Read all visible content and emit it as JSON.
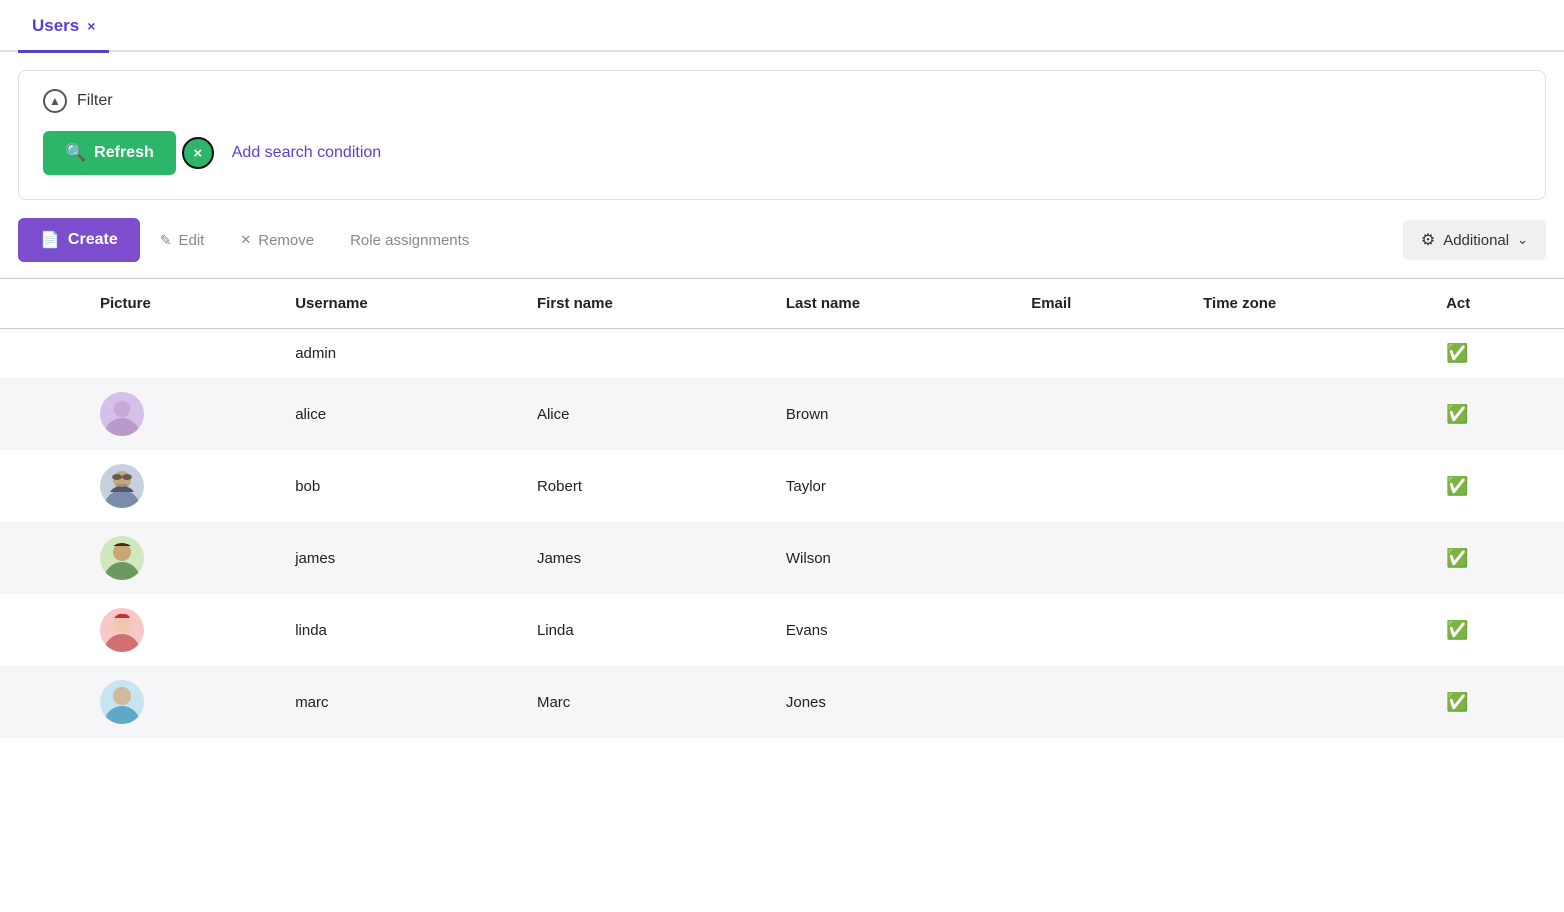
{
  "tab": {
    "label": "Users",
    "close": "×"
  },
  "filter": {
    "toggle_icon": "▲",
    "label": "Filter",
    "refresh_label": "Refresh",
    "add_search_label": "Add search condition",
    "x_icon": "×"
  },
  "toolbar": {
    "create_label": "Create",
    "edit_label": "Edit",
    "remove_label": "Remove",
    "role_assignments_label": "Role assignments",
    "additional_label": "Additional"
  },
  "table": {
    "columns": [
      "Picture",
      "Username",
      "First name",
      "Last name",
      "Email",
      "Time zone",
      "Act"
    ],
    "rows": [
      {
        "id": 1,
        "avatar": "",
        "username": "admin",
        "first_name": "",
        "last_name": "",
        "email": "",
        "time_zone": "",
        "active": true
      },
      {
        "id": 2,
        "avatar": "alice",
        "username": "alice",
        "first_name": "Alice",
        "last_name": "Brown",
        "email": "",
        "time_zone": "",
        "active": true
      },
      {
        "id": 3,
        "avatar": "bob",
        "username": "bob",
        "first_name": "Robert",
        "last_name": "Taylor",
        "email": "",
        "time_zone": "",
        "active": true
      },
      {
        "id": 4,
        "avatar": "james",
        "username": "james",
        "first_name": "James",
        "last_name": "Wilson",
        "email": "",
        "time_zone": "",
        "active": true
      },
      {
        "id": 5,
        "avatar": "linda",
        "username": "linda",
        "first_name": "Linda",
        "last_name": "Evans",
        "email": "",
        "time_zone": "",
        "active": true
      },
      {
        "id": 6,
        "avatar": "marc",
        "username": "marc",
        "first_name": "Marc",
        "last_name": "Jones",
        "email": "",
        "time_zone": "",
        "active": true
      }
    ]
  }
}
